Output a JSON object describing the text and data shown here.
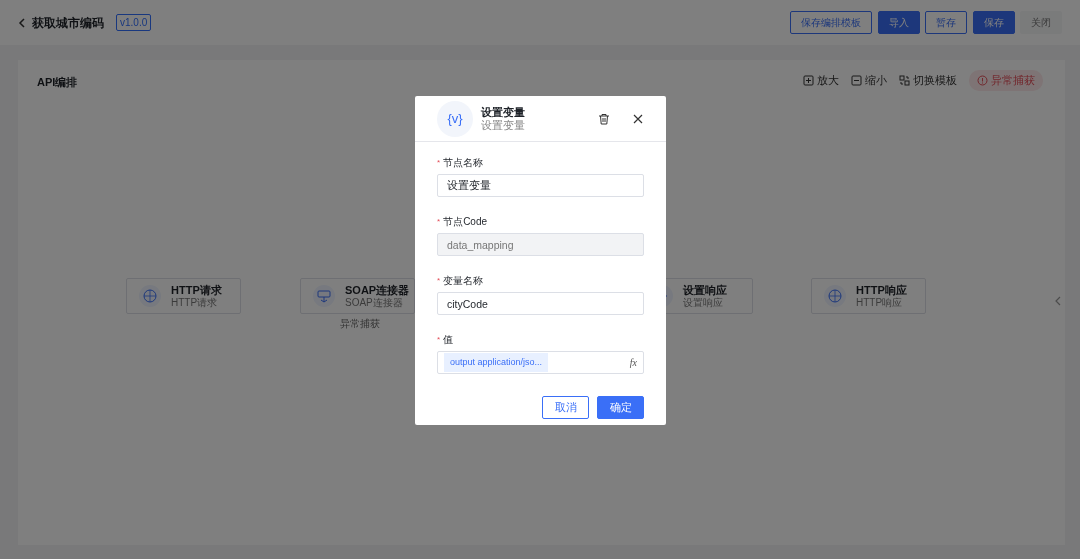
{
  "header": {
    "title": "获取城市编码",
    "version": "v1.0.0",
    "buttons": [
      {
        "label": "保存编排模板",
        "kind": "outline"
      },
      {
        "label": "导入",
        "kind": "primary"
      },
      {
        "label": "暂存",
        "kind": "outline"
      },
      {
        "label": "保存",
        "kind": "primary"
      },
      {
        "label": "关闭",
        "kind": "plain"
      }
    ]
  },
  "canvas": {
    "title": "API编排",
    "tools": [
      {
        "label": "放大",
        "kind": "zoom-in"
      },
      {
        "label": "缩小",
        "kind": "zoom-out"
      },
      {
        "label": "切换模板",
        "kind": "switch"
      },
      {
        "label": "异常捕获",
        "kind": "alert"
      }
    ],
    "nodes": [
      {
        "title": "HTTP请求",
        "subtitle": "HTTP请求",
        "kind": "http"
      },
      {
        "title": "SOAP连接器",
        "subtitle": "SOAP连接器",
        "kind": "soap",
        "caption": "异常捕获"
      },
      {
        "title": "设置响应",
        "subtitle": "设置响应",
        "kind": "response"
      },
      {
        "title": "HTTP响应",
        "subtitle": "HTTP响应",
        "kind": "http"
      }
    ]
  },
  "dialog": {
    "icon_text": "{v}",
    "title": "设置变量",
    "subtitle": "设置变量",
    "fields": [
      {
        "label": "节点名称",
        "required_mark": "*",
        "value": "设置变量",
        "disabled": false,
        "kind": "text"
      },
      {
        "label": "节点Code",
        "required_mark": "*",
        "value": "data_mapping",
        "disabled": true,
        "kind": "text"
      },
      {
        "label": "变量名称",
        "required_mark": "*",
        "value": "cityCode",
        "disabled": false,
        "kind": "text"
      },
      {
        "label": "值",
        "required_mark": "*",
        "value": "output application/jso...",
        "disabled": false,
        "kind": "expression",
        "fx": "fx"
      }
    ],
    "buttons": [
      {
        "label": "取消",
        "kind": "outline"
      },
      {
        "label": "确定",
        "kind": "primary"
      }
    ]
  }
}
